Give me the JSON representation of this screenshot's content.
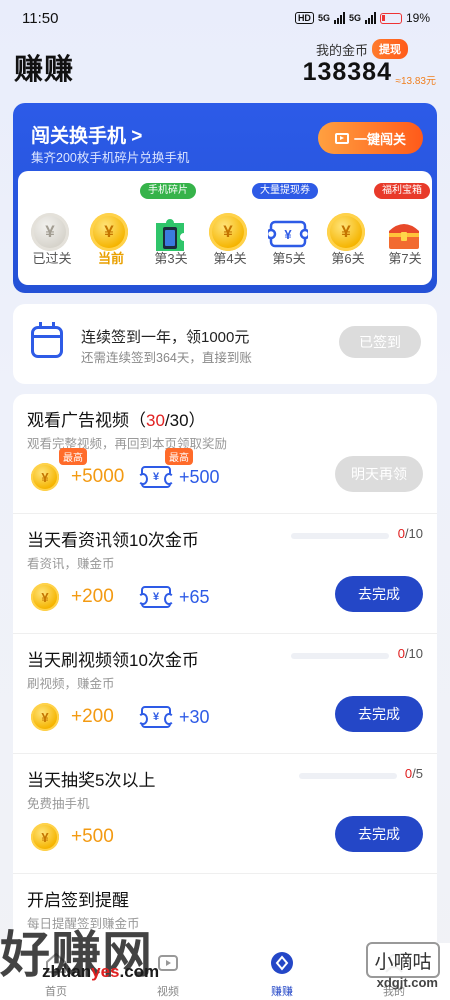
{
  "status_bar": {
    "time": "11:50",
    "hd": "HD",
    "network": "5G",
    "battery": "19%"
  },
  "header": {
    "title": "赚赚",
    "coin_label": "我的金币",
    "withdraw": "提现",
    "coins": "138384",
    "coins_yuan": "≈13.83元"
  },
  "level_card": {
    "title": "闯关换手机 >",
    "subtitle": "集齐200枚手机碎片兑换手机",
    "button": "一键闯关",
    "levels": [
      {
        "label": "已过关",
        "icon": "coin-grey-icon"
      },
      {
        "label": "当前",
        "icon": "coin-icon"
      },
      {
        "label": "第3关",
        "icon": "phone-fragment-icon",
        "tag": "手机碎片"
      },
      {
        "label": "第4关",
        "icon": "coin-icon"
      },
      {
        "label": "第5关",
        "icon": "ticket-icon",
        "tag": "大量提现券"
      },
      {
        "label": "第6关",
        "icon": "coin-icon"
      },
      {
        "label": "第7关",
        "icon": "treasure-chest-icon",
        "tag": "福利宝箱"
      }
    ]
  },
  "checkin": {
    "title": "连续签到一年，领1000元",
    "subtitle": "还需连续签到364天，直接到账",
    "button": "已签到"
  },
  "tasks": [
    {
      "title_pre": "观看广告视频（",
      "title_hl": "30",
      "title_post": "/30）",
      "subtitle": "观看完整视频，再回到本页领取奖励",
      "coin": "+5000",
      "ticket": "+500",
      "coin_tag": "最高",
      "ticket_tag": "最高",
      "button": "明天再领"
    },
    {
      "title": "当天看资讯领10次金币",
      "subtitle": "看资讯，赚金币",
      "coin": "+200",
      "ticket": "+65",
      "progress_cur": "0",
      "progress_total": "/10",
      "progress": 0,
      "button": "去完成"
    },
    {
      "title": "当天刷视频领10次金币",
      "subtitle": "刷视频，赚金币",
      "coin": "+200",
      "ticket": "+30",
      "progress_cur": "0",
      "progress_total": "/10",
      "progress": 0,
      "button": "去完成"
    },
    {
      "title": "当天抽奖5次以上",
      "subtitle": "免费抽手机",
      "coin": "+500",
      "progress_cur": "0",
      "progress_total": "/5",
      "progress": 0,
      "button": "去完成"
    },
    {
      "title": "开启签到提醒",
      "subtitle": "每日提醒签到赚金币"
    }
  ],
  "nav": [
    {
      "label": "首页",
      "icon": "home-icon"
    },
    {
      "label": "视频",
      "icon": "video-icon"
    },
    {
      "label": "赚赚",
      "icon": "earn-icon",
      "active": true
    },
    {
      "label": "我的",
      "icon": "profile-icon"
    }
  ],
  "watermark": {
    "text": "好赚网",
    "url_a": "zhuan",
    "url_b": "yes",
    "url_c": ".com",
    "badge": "小嘀咕",
    "badge_url": "xdgjt.com"
  },
  "colors": {
    "primary": "#2447c7",
    "accent": "#f39a12",
    "highlight": "#e02020",
    "orange": "#ff5a1a"
  }
}
